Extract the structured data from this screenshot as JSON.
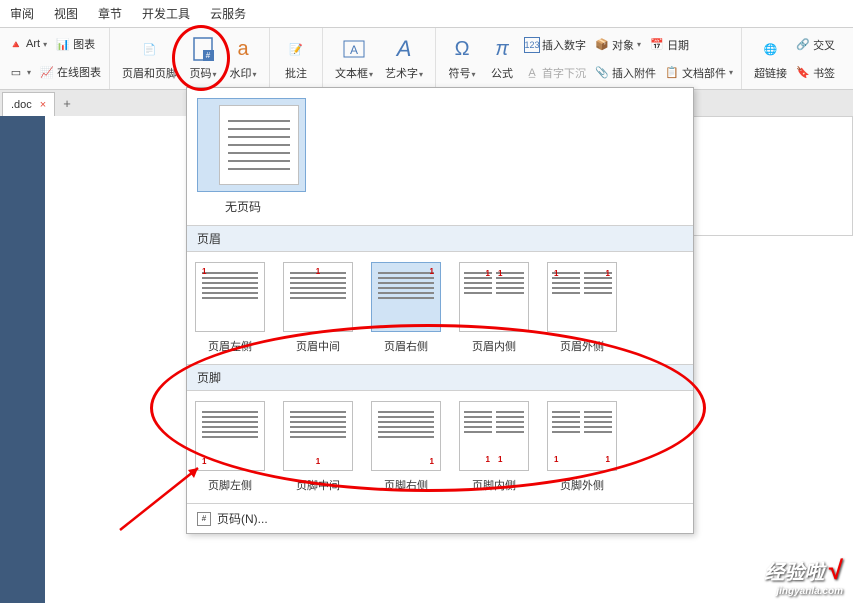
{
  "menubar": [
    "审阅",
    "视图",
    "章节",
    "开发工具",
    "云服务"
  ],
  "ribbon": {
    "g1": {
      "art": "Art",
      "chart": "图表",
      "online_chart": "在线图表"
    },
    "g2": {
      "header_footer": "页眉和页脚",
      "page_number": "页码",
      "watermark": "水印"
    },
    "g3": {
      "comment": "批注"
    },
    "g4": {
      "textbox": "文本框",
      "wordart": "艺术字"
    },
    "g5": {
      "symbol": "符号",
      "formula": "公式",
      "insert_number": "插入数字",
      "dropcap": "首字下沉",
      "object": "对象",
      "attachment": "插入附件",
      "date": "日期",
      "doc_parts": "文档部件"
    },
    "g6": {
      "hyperlink": "超链接",
      "bookmark": "书签",
      "cross": "交叉"
    }
  },
  "tab": {
    "name": ".doc",
    "close": "×",
    "plus": "+"
  },
  "dropdown": {
    "no_page": "无页码",
    "header_section": "页眉",
    "header_options": [
      "页眉左侧",
      "页眉中间",
      "页眉右侧",
      "页眉内侧",
      "页眉外侧"
    ],
    "footer_section": "页脚",
    "footer_options": [
      "页脚左侧",
      "页脚中间",
      "页脚右侧",
      "页脚内侧",
      "页脚外侧"
    ],
    "more": "页码(N)..."
  },
  "watermark": {
    "big": "经验啦",
    "check": "√",
    "small": "jingyanla.com"
  }
}
